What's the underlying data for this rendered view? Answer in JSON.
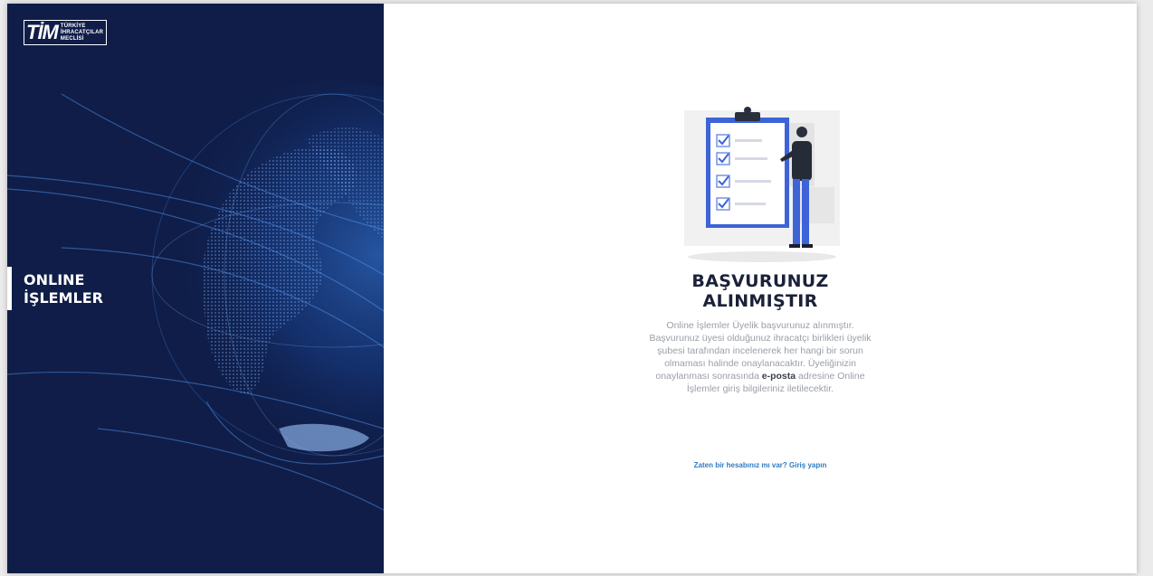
{
  "brand": {
    "logo_mark": "TİM",
    "logo_line1": "TÜRKİYE",
    "logo_line2": "İHRACATÇILAR",
    "logo_line3": "MECLİSİ"
  },
  "sidebar": {
    "title_line1": "ONLINE",
    "title_line2": "İŞLEMLER"
  },
  "main": {
    "heading_line1": "BAŞVURUNUZ",
    "heading_line2": "ALINMIŞTIR",
    "message_part1": "Online İşlemler Üyelik başvurunuz alınmıştır. Başvurunuz üyesi olduğunuz ihracatçı birlikleri üyelik şubesi tarafından incelenerek her hangi bir sorun olmaması halinde onaylanacaktır. Üyeliğinizin onaylanması sonrasında ",
    "message_bold": "e-posta",
    "message_part2": " adresine Online İşlemler giriş bilgileriniz iletilecektir.",
    "login_link": "Zaten bir hesabınız mı var? Giriş yapın"
  },
  "colors": {
    "sidebar_bg": "#0f1d48",
    "link": "#2f7bc2",
    "heading": "#1b2138",
    "clipboard_accent": "#3d63d6"
  },
  "icons": [
    "globe-illustration",
    "clipboard-checklist-illustration",
    "check-icon",
    "person-illustration"
  ]
}
